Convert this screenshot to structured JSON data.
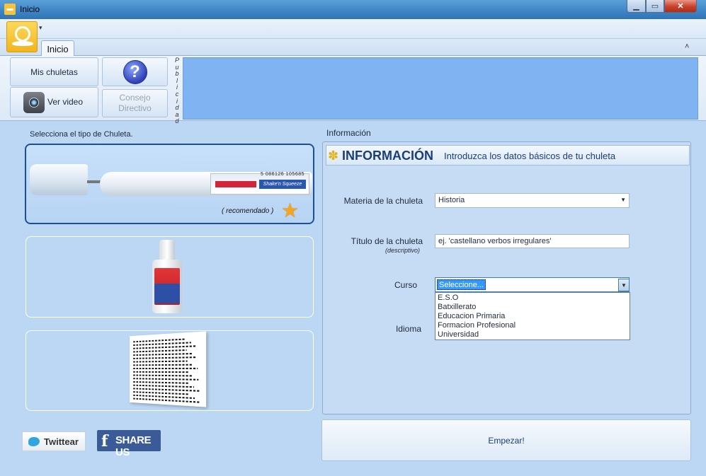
{
  "window": {
    "title": "Inicio",
    "min_label": "▁",
    "max_label": "▭",
    "close_label": "✕"
  },
  "ribbon": {
    "tab_label": "Inicio",
    "qa_dropdown": "▾",
    "collapse": "˄",
    "mis_chuletas_label": "Mis chuletas",
    "ver_video_label": "Ver video",
    "help_glyph": "?",
    "consejo_label_line1": "Consejo",
    "consejo_label_line2": "Directivo",
    "publicidad_label": "Publicidad"
  },
  "left": {
    "title": "Selecciona el tipo de Chuleta.",
    "pen_recommended": "( recomendado )",
    "pen_brand": "Shake'n Squeeze",
    "pen_barcode": "5 086126 105685",
    "twitter_label": "Twittear",
    "share_label": "SHARE US",
    "fb_glyph": "f",
    "star_glyph": "★"
  },
  "right": {
    "section_label": "Información",
    "header_title": "INFORMACIÓN",
    "header_subtitle": "Introduzca los datos básicos de tu chuleta",
    "puzzle_glyph": "✽",
    "materia_label": "Materia de la chuleta",
    "materia_value": "Historia",
    "titulo_label": "Título de la chuleta",
    "titulo_hint": "(descriptivo)",
    "titulo_placeholder": "ej. 'castellano verbos irregulares'",
    "curso_label": "Curso",
    "curso_selected": "Seleccione...",
    "curso_options": [
      "E.S.O",
      "Batxillerato",
      "Educacion Primaria",
      "Formacion Profesional",
      "Universidad"
    ],
    "idioma_label": "Idioma",
    "dropdown_arrow": "▼",
    "empezar_label": "Empezar!"
  },
  "colors": {
    "accent": "#1b3d78",
    "publicidad_bg": "#7fb3f1",
    "selection": "#3399ff"
  }
}
